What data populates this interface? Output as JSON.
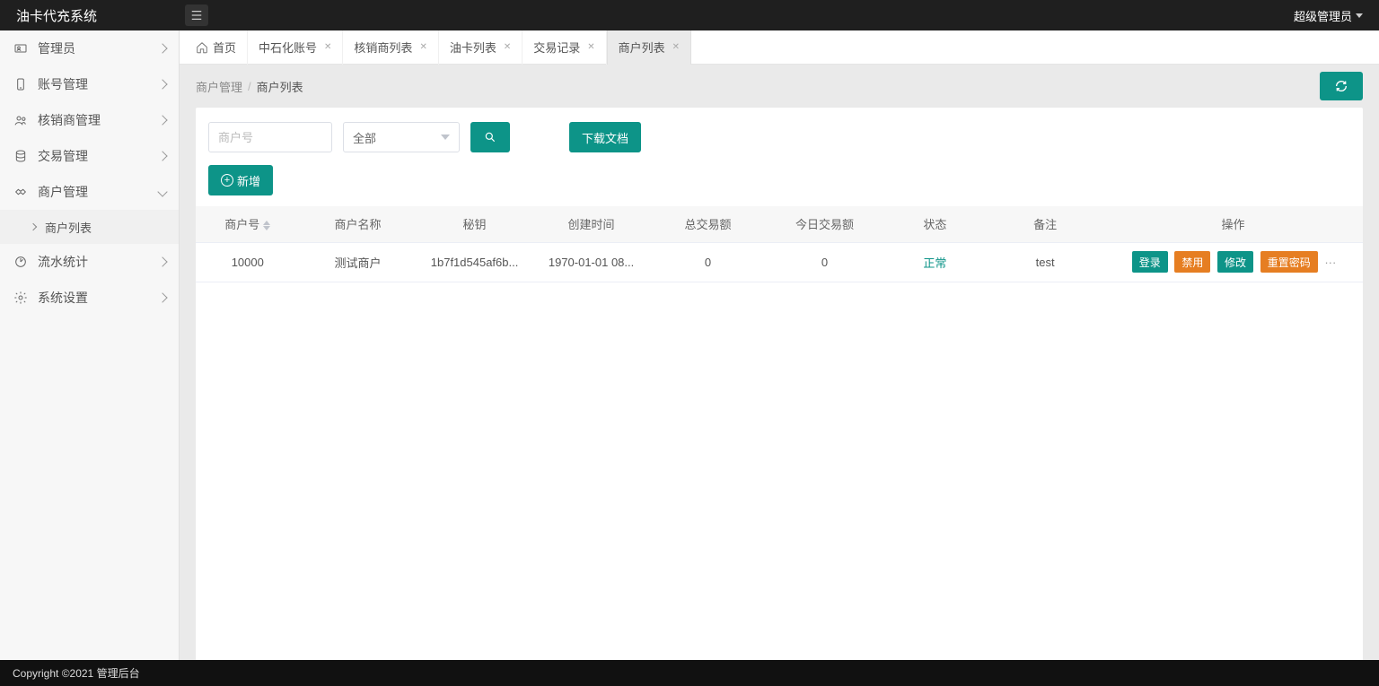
{
  "header": {
    "title": "油卡代充系统",
    "user_label": "超级管理员"
  },
  "sidebar": {
    "items": [
      {
        "label": "管理员",
        "expanded": false
      },
      {
        "label": "账号管理",
        "expanded": false
      },
      {
        "label": "核销商管理",
        "expanded": false
      },
      {
        "label": "交易管理",
        "expanded": false
      },
      {
        "label": "商户管理",
        "expanded": true,
        "children": [
          {
            "label": "商户列表"
          }
        ]
      },
      {
        "label": "流水统计",
        "expanded": false
      },
      {
        "label": "系统设置",
        "expanded": false
      }
    ]
  },
  "tabs": [
    {
      "label": "首页",
      "home": true,
      "closable": false
    },
    {
      "label": "中石化账号",
      "closable": true
    },
    {
      "label": "核销商列表",
      "closable": true
    },
    {
      "label": "油卡列表",
      "closable": true
    },
    {
      "label": "交易记录",
      "closable": true
    },
    {
      "label": "商户列表",
      "closable": true,
      "active": true
    }
  ],
  "breadcrumb": {
    "parent": "商户管理",
    "current": "商户列表"
  },
  "filters": {
    "merchant_placeholder": "商户号",
    "status_selected": "全部",
    "download_label": "下载文档",
    "add_label": "新增"
  },
  "table": {
    "headers": [
      "商户号",
      "商户名称",
      "秘钥",
      "创建时间",
      "总交易额",
      "今日交易额",
      "状态",
      "备注",
      "操作"
    ],
    "rows": [
      {
        "merchant_id": "10000",
        "merchant_name": "测试商户",
        "secret": "1b7f1d545af6b...",
        "created_at": "1970-01-01 08...",
        "total_amount": "0",
        "today_amount": "0",
        "status": "正常",
        "remark": "test"
      }
    ],
    "ops": {
      "login": "登录",
      "disable": "禁用",
      "edit": "修改",
      "reset_pwd": "重置密码"
    }
  },
  "footer": {
    "text": "Copyright ©2021 管理后台"
  }
}
